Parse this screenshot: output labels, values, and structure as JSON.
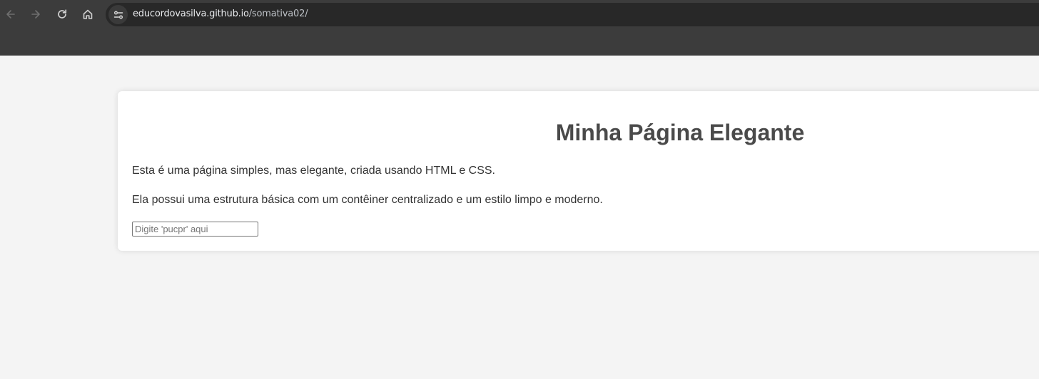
{
  "browser": {
    "nav": {
      "back_icon": "arrow-left-icon",
      "forward_icon": "arrow-right-icon",
      "reload_icon": "reload-icon",
      "home_icon": "home-icon"
    },
    "omnibox": {
      "site_info_icon": "tune-icon",
      "url_host": "educordovasilva.github.io",
      "url_path": "/somativa02/"
    },
    "colors": {
      "toolbar": "#3c3c3c",
      "omnibox": "#282828"
    }
  },
  "page": {
    "title": "Minha Página Elegante",
    "paragraphs": [
      "Esta é uma página simples, mas elegante, criada usando HTML e CSS.",
      "Ela possui uma estrutura básica com um contêiner centralizado e um estilo limpo e moderno."
    ],
    "input": {
      "placeholder": "Digite 'pucpr' aqui",
      "value": ""
    },
    "colors": {
      "background": "#f4f4f4",
      "container": "#ffffff",
      "title": "#4a4a4a",
      "text": "#333333"
    }
  }
}
